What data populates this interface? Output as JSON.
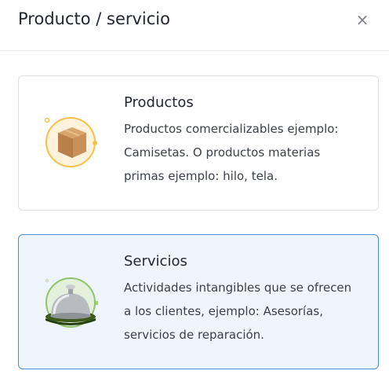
{
  "dialog": {
    "title": "Producto / servicio",
    "close_glyph": "×"
  },
  "options": [
    {
      "title": "Productos",
      "description": "Productos comercializables ejemplo: Camisetas. O productos materias primas ejemplo: hilo, tela.",
      "icon": "cardboard-box-icon",
      "selected": false
    },
    {
      "title": "Servicios",
      "description": "Actividades intangibles que se ofrecen a los clientes, ejemplo: Asesorías, servicios de reparación.",
      "icon": "service-bell-icon",
      "selected": true
    }
  ],
  "colors": {
    "selected_border": "#4a8fcf",
    "selected_background": "#eef5fc",
    "card_border": "#dcdfe4"
  }
}
